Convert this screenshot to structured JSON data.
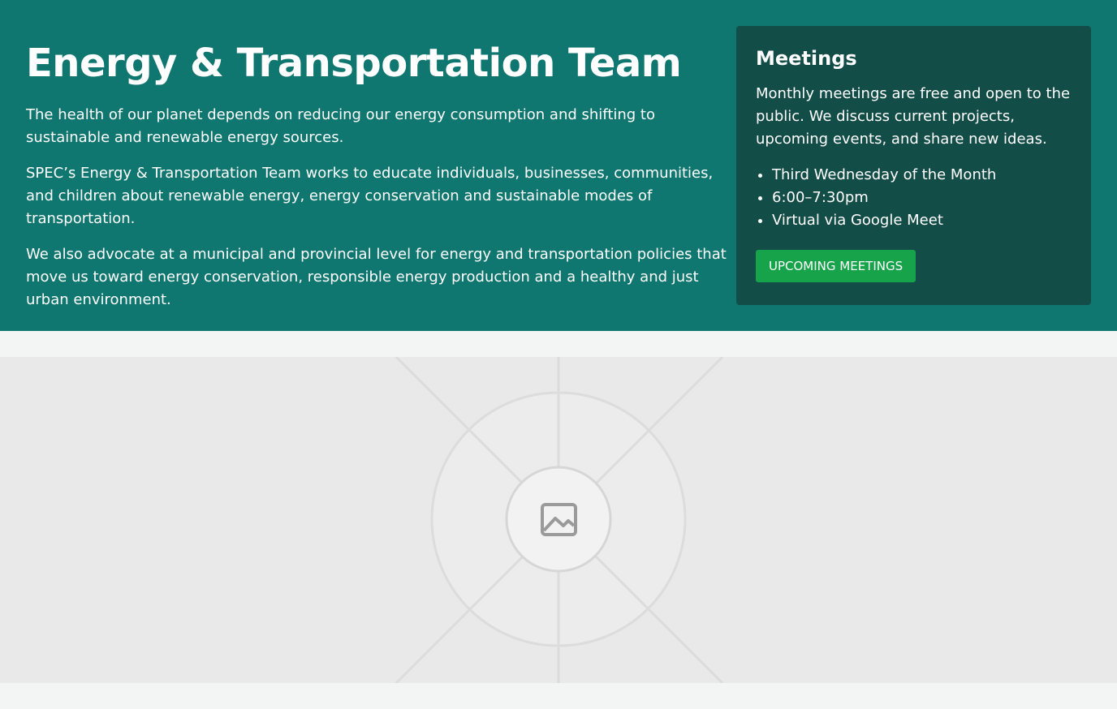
{
  "hero": {
    "title": "Energy & Transportation Team",
    "paragraphs": [
      "The health of our planet depends on reducing our energy consumption and shifting to sustainable and renewable energy sources.",
      "SPEC’s Energy & Transportation Team works to educate individuals, businesses, communities, and children about renewable energy, energy conservation and sustainable modes of transportation.",
      "We also advocate at a municipal and provincial level for energy and transportation policies that move us toward energy conservation, responsible energy production and a healthy and just urban environment."
    ],
    "background_color": "#0f7670"
  },
  "meetings": {
    "title": "Meetings",
    "description": "Monthly meetings are free and open to the public. We discuss current projects, upcoming events, and share new ideas.",
    "details": [
      "Third Wednesday of the Month",
      "6:00–7:30pm",
      "Virtual via Google Meet"
    ],
    "button_label": "UPCOMING MEETINGS",
    "card_color": "#134d48",
    "button_color": "#16a34a"
  },
  "image": {
    "icon": "image-icon"
  }
}
